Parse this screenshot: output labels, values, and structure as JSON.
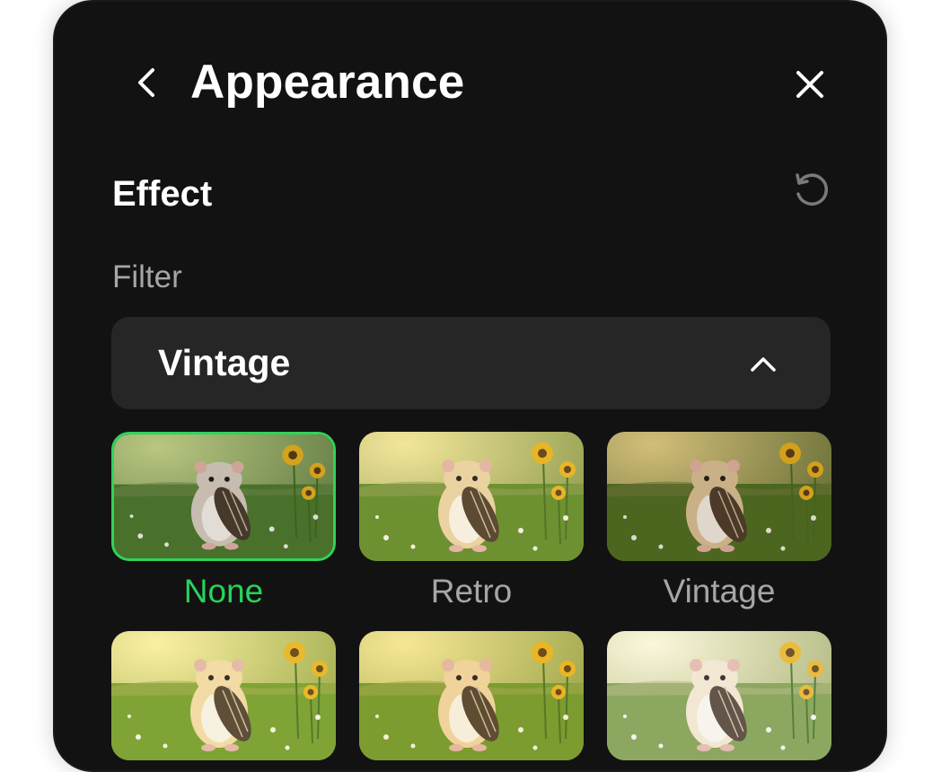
{
  "header": {
    "title": "Appearance",
    "back_icon": "chevron-left-icon",
    "close_icon": "close-icon"
  },
  "section": {
    "title": "Effect",
    "reset_icon": "reset-icon"
  },
  "filter": {
    "label": "Filter",
    "selected_value": "Vintage",
    "expanded_icon": "chevron-up-icon"
  },
  "filters": [
    {
      "label": "None",
      "selected": true
    },
    {
      "label": "Retro",
      "selected": false
    },
    {
      "label": "Vintage",
      "selected": false
    },
    {
      "label": "",
      "selected": false
    },
    {
      "label": "",
      "selected": false
    },
    {
      "label": "",
      "selected": false
    }
  ],
  "colors": {
    "panel_bg": "#121212",
    "dropdown_bg": "#262626",
    "accent": "#2FD35A",
    "muted_text": "#A6A6A6",
    "primary_text": "#FFFFFF"
  }
}
